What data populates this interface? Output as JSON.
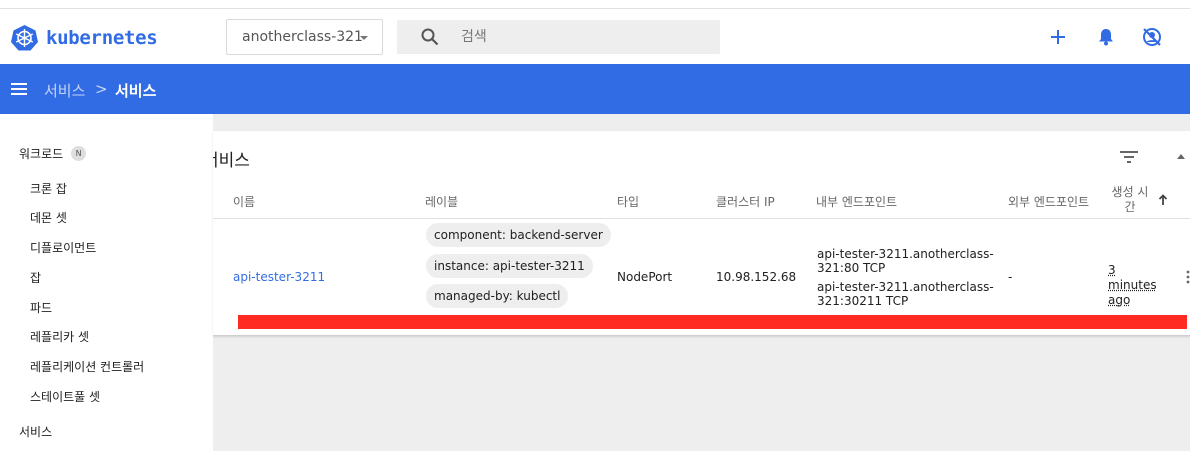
{
  "header": {
    "brand": "kubernetes",
    "namespace": "anotherclass-321",
    "search_placeholder": "검색",
    "icons": [
      "plus-icon",
      "bell-icon",
      "account-off-icon"
    ]
  },
  "toolbar": {
    "breadcrumb_parent": "서비스",
    "breadcrumb_separator": ">",
    "breadcrumb_current": "서비스"
  },
  "sidebar": {
    "section_workloads": "워크로드",
    "section_badge": "N",
    "items": [
      "크론 잡",
      "데몬 셋",
      "디플로이먼트",
      "잡",
      "파드",
      "레플리카 셋",
      "레플리케이션 컨트롤러",
      "스테이트풀 셋"
    ],
    "section_services": "서비스"
  },
  "card": {
    "title": "서비스",
    "columns": {
      "name": "이름",
      "labels": "레이블",
      "type": "타입",
      "cluster_ip": "클러스터 IP",
      "internal_endpoints": "내부 엔드포인트",
      "external_endpoints": "외부 엔드포인트",
      "age": "생성 시간"
    },
    "rows": [
      {
        "name": "api-tester-3211",
        "labels": [
          "component: backend-server",
          "instance: api-tester-3211",
          "managed-by: kubectl"
        ],
        "type": "NodePort",
        "cluster_ip": "10.98.152.68",
        "internal_endpoints": [
          "api-tester-3211.anotherclass-321:80 TCP",
          "api-tester-3211.anotherclass-321:30211 TCP"
        ],
        "external_endpoints": "-",
        "age": "3 minutes ago"
      }
    ]
  },
  "colors": {
    "brand_blue": "#326ce5",
    "highlight_red": "#ff2a22"
  }
}
